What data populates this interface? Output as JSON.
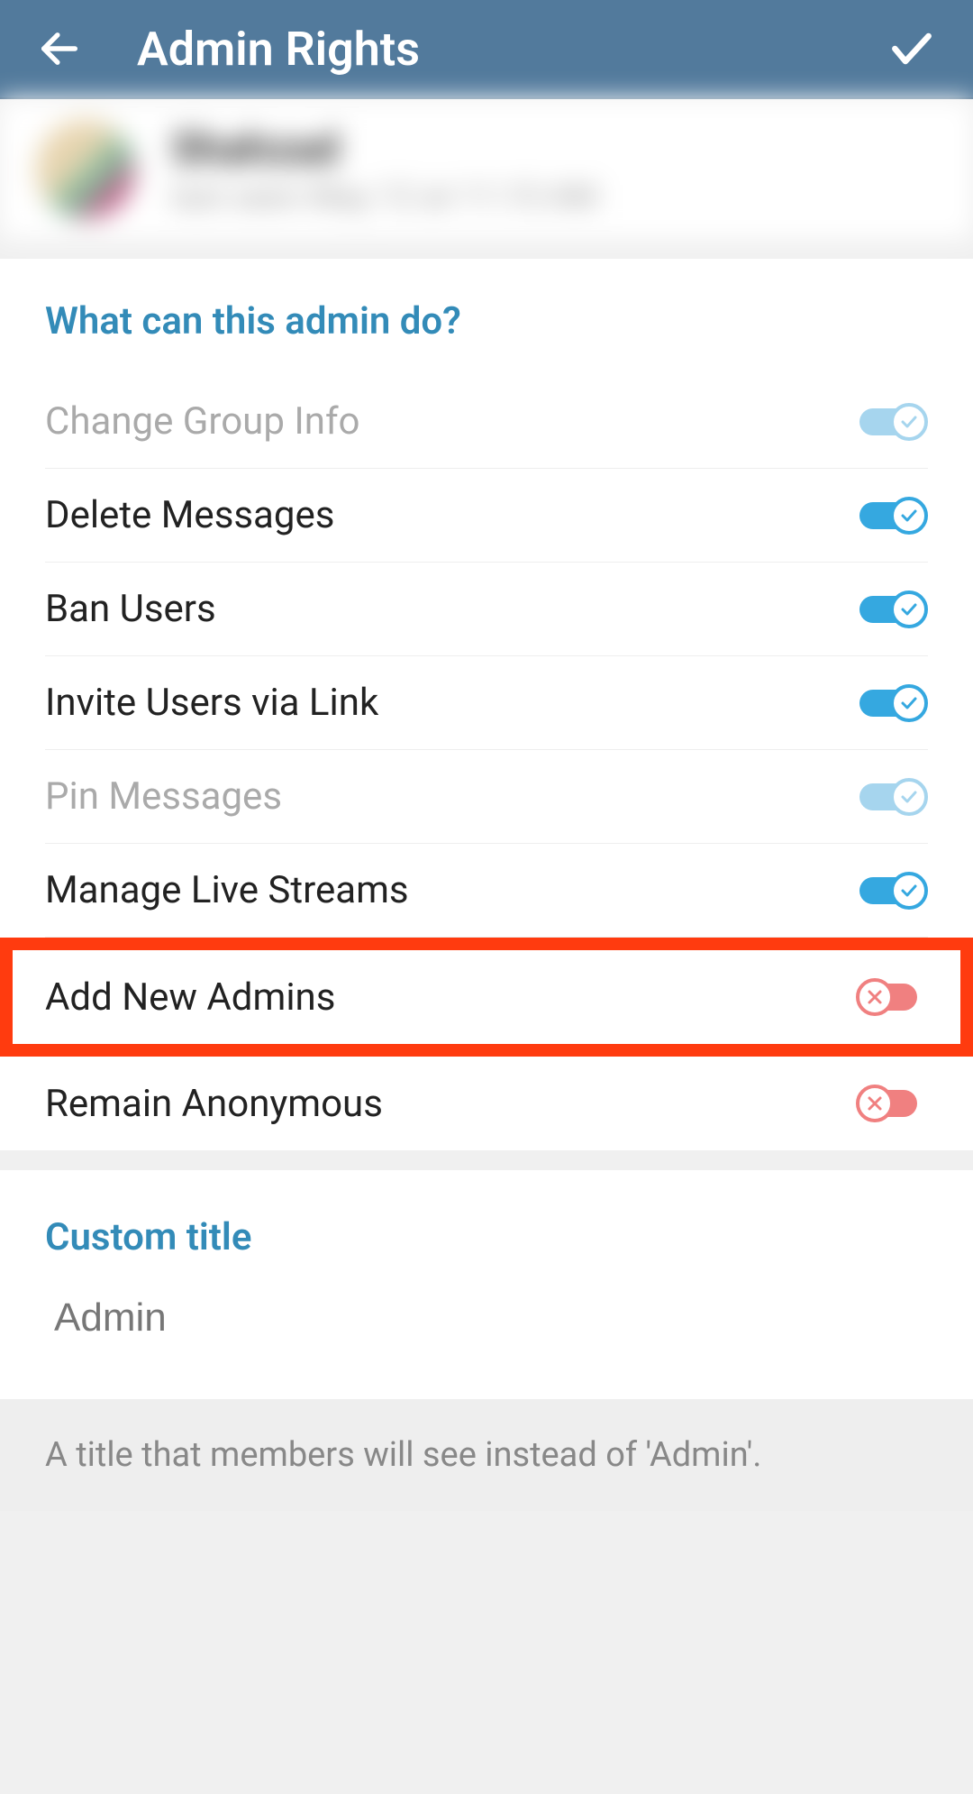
{
  "header": {
    "title": "Admin Rights"
  },
  "profile": {
    "name": "Shahzad",
    "status": "last seen May 12 at 11:15 AM"
  },
  "permissions": {
    "header": "What can this admin do?",
    "items": [
      {
        "label": "Change Group Info",
        "on": true,
        "disabled": true,
        "highlighted": false
      },
      {
        "label": "Delete Messages",
        "on": true,
        "disabled": false,
        "highlighted": false
      },
      {
        "label": "Ban Users",
        "on": true,
        "disabled": false,
        "highlighted": false
      },
      {
        "label": "Invite Users via Link",
        "on": true,
        "disabled": false,
        "highlighted": false
      },
      {
        "label": "Pin Messages",
        "on": true,
        "disabled": true,
        "highlighted": false
      },
      {
        "label": "Manage Live Streams",
        "on": true,
        "disabled": false,
        "highlighted": false
      },
      {
        "label": "Add New Admins",
        "on": false,
        "disabled": false,
        "highlighted": true
      },
      {
        "label": "Remain Anonymous",
        "on": false,
        "disabled": false,
        "highlighted": false
      }
    ]
  },
  "custom_title": {
    "header": "Custom title",
    "value": "Admin",
    "note": "A title that members will see instead of 'Admin'."
  }
}
